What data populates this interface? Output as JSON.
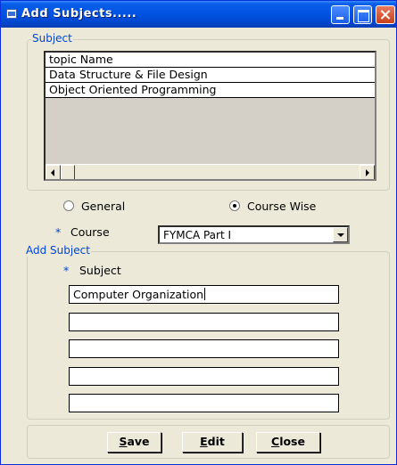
{
  "window": {
    "title": "Add Subjects....."
  },
  "subject_frame": {
    "legend": "Subject",
    "rows": [
      "topic Name",
      "Data Structure & File Design",
      "Object Oriented Programming"
    ]
  },
  "options": {
    "general_label": "General",
    "course_wise_label": "Course Wise",
    "selected": "Course Wise"
  },
  "course": {
    "required_mark": "*",
    "label": "Course",
    "value": "FYMCA Part I"
  },
  "add_subject_frame": {
    "legend": "Add Subject",
    "required_mark": "*",
    "label": "Subject",
    "fields": [
      "Computer Organization",
      "",
      "",
      "",
      ""
    ]
  },
  "buttons": {
    "save": {
      "accel": "S",
      "rest": "ave"
    },
    "edit": {
      "accel": "E",
      "rest": "dit"
    },
    "close": {
      "accel": "C",
      "rest": "lose"
    }
  }
}
